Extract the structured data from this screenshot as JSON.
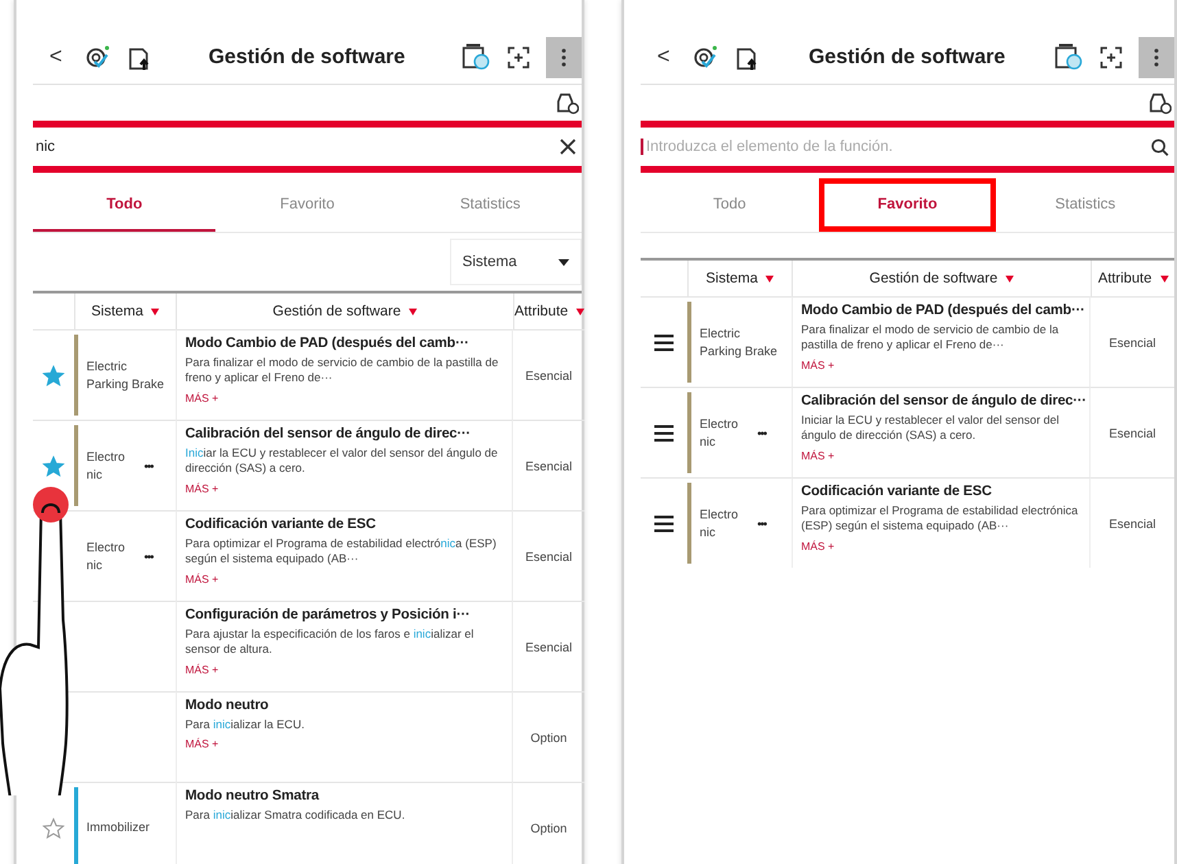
{
  "screens": [
    {
      "header": {
        "back": "<",
        "title": "Gestión de software"
      },
      "search": {
        "kind": "clear",
        "value": "nic"
      },
      "tabs": [
        {
          "label": "Todo",
          "selected": true,
          "annotated": false
        },
        {
          "label": "Favorito",
          "selected": false,
          "annotated": false
        },
        {
          "label": "Statistics",
          "selected": false,
          "annotated": false
        }
      ],
      "filter": {
        "value": "Sistema"
      },
      "columns": [
        "Sistema",
        "Gestión de software",
        "Attribute"
      ],
      "rows": [
        {
          "kind": "star",
          "favorite": true,
          "system": "Electric Parking Brake",
          "color": "#a89a72",
          "title": "Modo Cambio de PAD (después del camb···",
          "description": [
            {
              "text": "Para finalizar el modo de servicio de cambio de la pastilla de freno y aplicar el Freno de···",
              "match": false
            }
          ],
          "link": "MÁS +",
          "attribute": "Esencial"
        },
        {
          "kind": "star",
          "favorite": true,
          "system": "Electro nic",
          "more": "•••",
          "color": "#a89a72",
          "title": "Calibración del sensor de ángulo de direc···",
          "description": [
            {
              "text": "Inic",
              "match": true
            },
            {
              "text": "iar la ECU y restablecer el valor del sensor del ángulo de dirección (SAS) a cero.",
              "match": false
            }
          ],
          "link": "MÁS +",
          "attribute": "Esencial"
        },
        {
          "kind": "plain",
          "system": "Electro nic",
          "more": "•••",
          "title": "Codificación variante de ESC",
          "description": [
            {
              "text": "Para optimizar el Programa de estabilidad electró",
              "match": false
            },
            {
              "text": "nic",
              "match": true
            },
            {
              "text": "a (ESP) según el sistema equipado (AB···",
              "match": false
            }
          ],
          "link": "MÁS +",
          "attribute": "Esencial"
        },
        {
          "kind": "plain",
          "title": "Configuración de parámetros y Posición i···",
          "description": [
            {
              "text": "Para ajustar la especificación de los faros e ",
              "match": false
            },
            {
              "text": "inic",
              "match": true
            },
            {
              "text": "ializar el sensor de altura.",
              "match": false
            }
          ],
          "link": "MÁS +",
          "attribute": "Esencial"
        },
        {
          "kind": "plain",
          "title": "Modo neutro",
          "description": [
            {
              "text": "Para ",
              "match": false
            },
            {
              "text": "inic",
              "match": true
            },
            {
              "text": "ializar la ECU.",
              "match": false
            }
          ],
          "link": "MÁS +",
          "attribute": "Option"
        },
        {
          "kind": "star",
          "favorite": false,
          "system": "Immobilizer",
          "color": "#27a9d6",
          "title": "Modo neutro Smatra",
          "description": [
            {
              "text": "Para ",
              "match": false
            },
            {
              "text": "inic",
              "match": true
            },
            {
              "text": "ializar Smatra codificada en ECU.",
              "match": false
            }
          ],
          "attribute": "Option"
        }
      ],
      "overlay": {
        "kind": "tap"
      }
    },
    {
      "header": {
        "back": "<",
        "title": "Gestión de software"
      },
      "search": {
        "kind": "search",
        "placeholder": "Introduzca el elemento de la función."
      },
      "tabs": [
        {
          "label": "Todo",
          "selected": false,
          "annotated": false
        },
        {
          "label": "Favorito",
          "selected": true,
          "annotated": true
        },
        {
          "label": "Statistics",
          "selected": false,
          "annotated": false
        }
      ],
      "columns": [
        "Sistema",
        "Gestión de software",
        "Attribute"
      ],
      "rows": [
        {
          "kind": "handle",
          "system": "Electric Parking Brake",
          "color": "#a89a72",
          "title": "Modo Cambio de PAD (después del camb···",
          "description": [
            {
              "text": "Para finalizar el modo de servicio de cambio de la pastilla de freno y aplicar el Freno de···",
              "match": false
            }
          ],
          "link": "MÁS +",
          "attribute": "Esencial"
        },
        {
          "kind": "handle",
          "system": "Electro nic",
          "more": "•••",
          "color": "#a89a72",
          "title": "Calibración del sensor de ángulo de direc···",
          "description": [
            {
              "text": "Iniciar la ECU y restablecer el valor del sensor del ángulo de dirección (SAS) a cero.",
              "match": false
            }
          ],
          "link": "MÁS +",
          "attribute": "Esencial"
        },
        {
          "kind": "handle",
          "system": "Electro nic",
          "more": "•••",
          "color": "#a89a72",
          "title": "Codificación variante de ESC",
          "description": [
            {
              "text": "Para optimizar el Programa de estabilidad electrónica (ESP) según el sistema equipado (AB···",
              "match": false
            }
          ],
          "link": "MÁS +",
          "attribute": "Esencial"
        }
      ]
    }
  ]
}
